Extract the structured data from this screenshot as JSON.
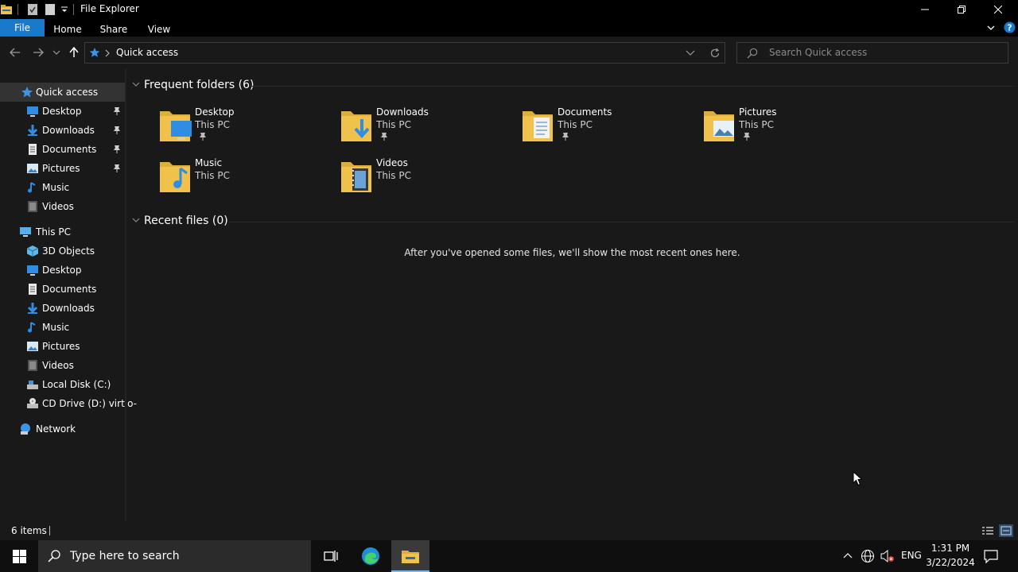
{
  "window": {
    "title": "File Explorer"
  },
  "ribbon": {
    "tabs": [
      "File",
      "Home",
      "Share",
      "View"
    ]
  },
  "address": {
    "location": "Quick access"
  },
  "search": {
    "placeholder": "Search Quick access"
  },
  "sidebar": {
    "quick_access": {
      "label": "Quick access",
      "items": [
        {
          "label": "Desktop",
          "icon": "desktop-icon",
          "pinned": true
        },
        {
          "label": "Downloads",
          "icon": "downloads-icon",
          "pinned": true
        },
        {
          "label": "Documents",
          "icon": "documents-icon",
          "pinned": true
        },
        {
          "label": "Pictures",
          "icon": "pictures-icon",
          "pinned": true
        },
        {
          "label": "Music",
          "icon": "music-icon",
          "pinned": false
        },
        {
          "label": "Videos",
          "icon": "videos-icon",
          "pinned": false
        }
      ]
    },
    "this_pc": {
      "label": "This PC",
      "items": [
        {
          "label": "3D Objects",
          "icon": "3d-objects-icon"
        },
        {
          "label": "Desktop",
          "icon": "desktop-icon"
        },
        {
          "label": "Documents",
          "icon": "documents-icon"
        },
        {
          "label": "Downloads",
          "icon": "downloads-icon"
        },
        {
          "label": "Music",
          "icon": "music-icon"
        },
        {
          "label": "Pictures",
          "icon": "pictures-icon"
        },
        {
          "label": "Videos",
          "icon": "videos-icon"
        },
        {
          "label": "Local Disk (C:)",
          "icon": "local-disk-icon"
        },
        {
          "label": "CD Drive (D:) virtio-",
          "icon": "cd-drive-icon"
        }
      ]
    },
    "network": {
      "label": "Network"
    }
  },
  "content": {
    "frequent": {
      "heading": "Frequent folders (6)",
      "folders": [
        {
          "name": "Desktop",
          "location": "This PC",
          "pinned": true
        },
        {
          "name": "Downloads",
          "location": "This PC",
          "pinned": true
        },
        {
          "name": "Documents",
          "location": "This PC",
          "pinned": true
        },
        {
          "name": "Pictures",
          "location": "This PC",
          "pinned": true
        },
        {
          "name": "Music",
          "location": "This PC",
          "pinned": false
        },
        {
          "name": "Videos",
          "location": "This PC",
          "pinned": false
        }
      ]
    },
    "recent": {
      "heading": "Recent files (0)",
      "empty_message": "After you've opened some files, we'll show the most recent ones here."
    }
  },
  "status": {
    "items": "6 items"
  },
  "taskbar": {
    "search_placeholder": "Type here to search",
    "language": "ENG",
    "time": "1:31 PM",
    "date": "3/22/2024"
  },
  "colors": {
    "accent": "#1979ca",
    "folder": "#f0c24b",
    "background": "#191919"
  }
}
